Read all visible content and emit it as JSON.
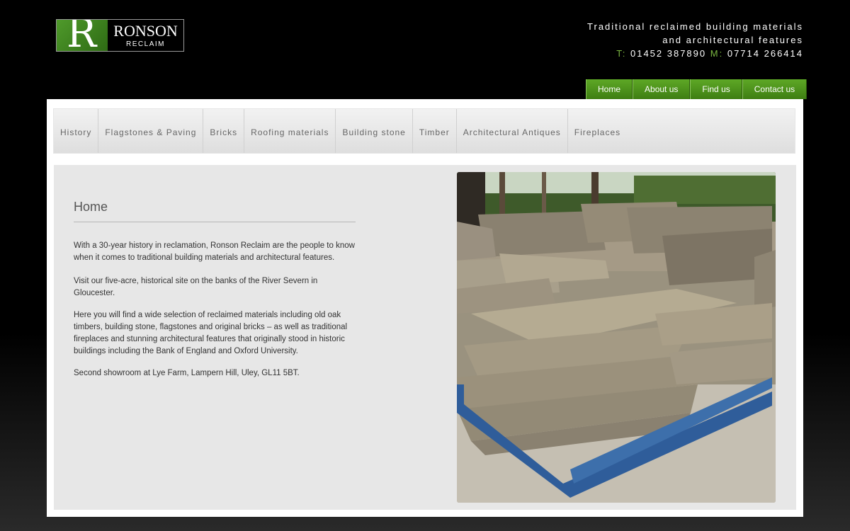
{
  "logo": {
    "mark": "R",
    "name": "RONSON",
    "sub": "RECLAIM"
  },
  "tagline": {
    "line1": "Traditional reclaimed building materials",
    "line2": "and architectural features",
    "tel_label": "T:",
    "tel": "01452 387890",
    "mob_label": "M:",
    "mob": "07714 266414"
  },
  "topnav": [
    "Home",
    "About us",
    "Find us",
    "Contact us"
  ],
  "catnav": [
    "History",
    "Flagstones & Paving",
    "Bricks",
    "Roofing materials",
    "Building stone",
    "Timber",
    "Architectural Antiques",
    "Fireplaces"
  ],
  "main": {
    "title": "Home",
    "p1": "With a 30-year history in reclamation, Ronson Reclaim are the people to know when it comes to traditional building materials and architectural features.",
    "p2": "Visit our five-acre, historical site on the banks of the River Severn in Gloucester.",
    "p3": "Here you will find a wide selection of reclaimed materials including old oak timbers, building stone, flagstones and original bricks – as well as traditional fireplaces and stunning architectural features that originally stood in historic buildings including the Bank of England and Oxford University.",
    "p4": "Second showroom at Lye Farm, Lampern Hill, Uley, GL11 5BT."
  },
  "colors": {
    "accent": "#4f9a2b",
    "label_green": "#7cb842"
  }
}
